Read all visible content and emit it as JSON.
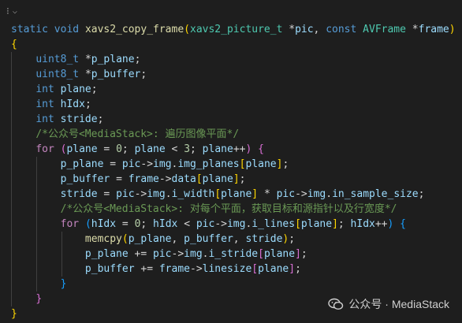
{
  "editor": {
    "fold_marker": "⁝",
    "lines": [
      "static void xavs2_copy_frame(xavs2_picture_t *pic, const AVFrame *frame)",
      "{",
      "    uint8_t *p_plane;",
      "    uint8_t *p_buffer;",
      "    int plane;",
      "    int hIdx;",
      "    int stride;",
      "    /*公众号<MediaStack>: 遍历图像平面*/",
      "    for (plane = 0; plane < 3; plane++) {",
      "        p_plane = pic->img.img_planes[plane];",
      "        p_buffer = frame->data[plane];",
      "        stride = pic->img.i_width[plane] * pic->img.in_sample_size;",
      "        /*公众号<MediaStack>: 对每个平面，获取目标和源指针以及行宽度*/",
      "        for (hIdx = 0; hIdx < pic->img.i_lines[plane]; hIdx++) {",
      "            memcpy(p_plane, p_buffer, stride);",
      "            p_plane += pic->img.i_stride[plane];",
      "            p_buffer += frame->linesize[plane];",
      "        }",
      "    }",
      "}"
    ]
  },
  "watermark": {
    "text": "公众号 · MediaStack"
  },
  "colors": {
    "background": "#1e1e1e",
    "keyword": "#569cd6",
    "control": "#c586c0",
    "function": "#dcdcaa",
    "type": "#4ec9b0",
    "variable": "#9cdcfe",
    "number": "#b5cea8",
    "comment": "#6a9955"
  }
}
